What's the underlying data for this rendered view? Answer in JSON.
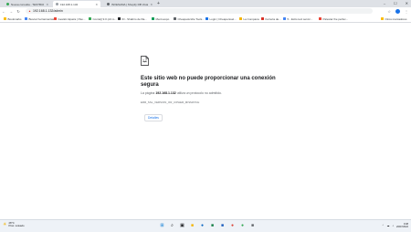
{
  "browser": {
    "tabs": [
      {
        "label": "Nueva consulta - TESTBUR Ga...",
        "color": "#34a853",
        "active": false
      },
      {
        "label": "192.168.1.132",
        "color": "#9aa0a6",
        "active": true
      },
      {
        "label": "INVESAMA | Shopify DB Vista O...",
        "color": "#5f6368",
        "active": false
      }
    ],
    "new_tab": "+",
    "window_controls": [
      "–",
      "☐",
      "✕"
    ]
  },
  "toolbar": {
    "back": "←",
    "forward": "→",
    "reload": "↻",
    "security_icon": "▲",
    "address": "192.168.1.132/admin",
    "right_icons": [
      "☆",
      "⋮"
    ]
  },
  "bookmarks": {
    "items": [
      {
        "label": "Bookmarks",
        "color": "#fbbc04"
      },
      {
        "label": "Buscar herramientas",
        "color": "#4285f4"
      },
      {
        "label": "Gestión Epaza | Pao...",
        "color": "#ea4335"
      },
      {
        "label": "ContaQ 9.0 (ofi ro...",
        "color": "#34a853"
      },
      {
        "label": "ID - Shabrio de fila...",
        "color": "#202124"
      },
      {
        "label": "Mercoexpo",
        "color": "#0f9d58"
      },
      {
        "label": "Cheapestcsfie Tools...",
        "color": "#5f6368"
      },
      {
        "label": "Login | Cheaperssel...",
        "color": "#1a73e8"
      },
      {
        "label": "La Compana",
        "color": "#f4b400"
      },
      {
        "label": "Ferreria de...",
        "color": "#d93025"
      },
      {
        "label": "5 - Exito text servic...",
        "color": "#4285f4"
      },
      {
        "label": "Palestar the perfec...",
        "color": "#ea4335"
      }
    ],
    "other": "Otros marcadores"
  },
  "error_page": {
    "title": "Este sitio web no puede proporcionar una conexión segura",
    "desc_prefix": "La página ",
    "host": "192.168.1.132",
    "desc_suffix": " utiliza un protocolo no admitido.",
    "code": "ERR_SSL_VERSION_OR_CIPHER_MISMATCH",
    "details_label": "Detalles"
  },
  "taskbar": {
    "weather_icon": "☀",
    "temperature": "28°C",
    "condition": "Prac. soleado",
    "apps": [
      {
        "glyph": "⊞",
        "color": "#0078d4"
      },
      {
        "glyph": "⌕",
        "color": "#202124"
      },
      {
        "glyph": "▣",
        "color": "#202124"
      },
      {
        "glyph": "■",
        "color": "#f4b400"
      },
      {
        "glyph": "●",
        "color": "#0a66c2"
      },
      {
        "glyph": "■",
        "color": "#107c41"
      },
      {
        "glyph": "■",
        "color": "#185abd"
      },
      {
        "glyph": "●",
        "color": "#db4437"
      },
      {
        "glyph": "●",
        "color": "#34a853"
      },
      {
        "glyph": "■",
        "color": "#5f6368"
      }
    ],
    "tray_icons": [
      "⌃",
      "☁",
      "♪"
    ],
    "time": "9:38",
    "date": "26/07/2022"
  }
}
